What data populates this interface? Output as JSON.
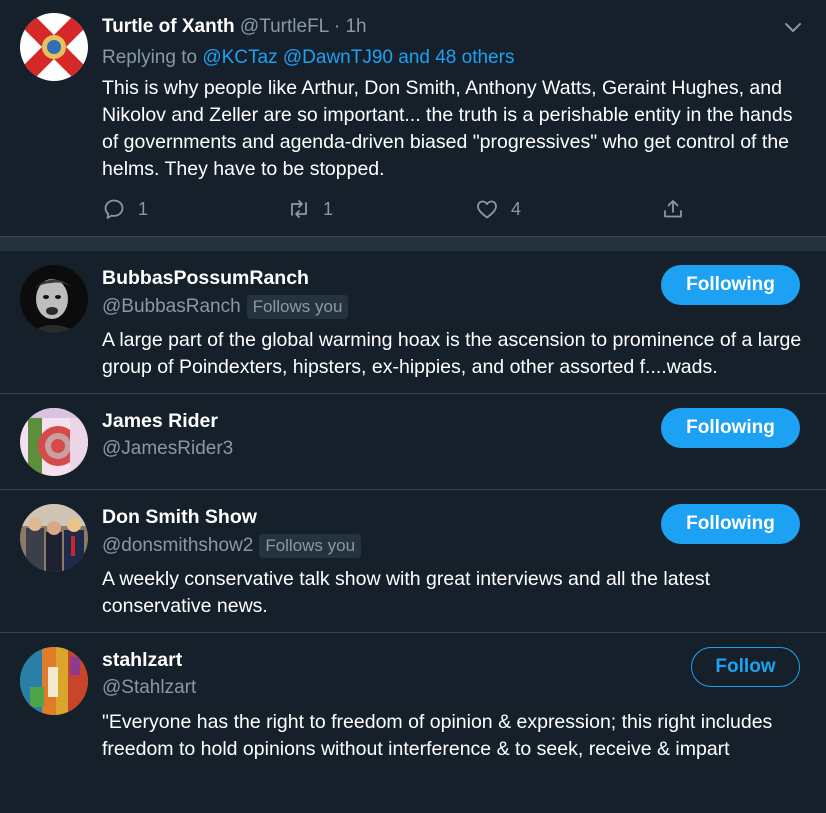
{
  "tweet": {
    "author_name": "Turtle of Xanth",
    "author_handle": "@TurtleFL",
    "dot": "·",
    "time": "1h",
    "replying_prefix": "Replying to",
    "replying_links": "@KCTaz @DawnTJ90 and 48 others",
    "text": "This is why people like Arthur, Don Smith, Anthony Watts, Geraint Hughes, and Nikolov and Zeller are so important... the truth is a perishable entity in the hands of governments and agenda-driven biased \"progressives\" who get control of the helms. They have to be stopped.",
    "reply_count": "1",
    "retweet_count": "1",
    "like_count": "4"
  },
  "users": [
    {
      "name": "BubbasPossumRanch",
      "handle": "@BubbasRanch",
      "follows_you": "Follows you",
      "bio": "A large part of the global warming hoax is the ascension to prominence of a large group of Poindexters, hipsters, ex-hippies, and other assorted f....wads.",
      "button": "Following"
    },
    {
      "name": "James Rider",
      "handle": "@JamesRider3",
      "button": "Following"
    },
    {
      "name": "Don Smith Show",
      "handle": "@donsmithshow2",
      "follows_you": "Follows you",
      "bio": "A weekly conservative talk show with great interviews and all the latest conservative news.",
      "button": "Following"
    },
    {
      "name": "stahlzart",
      "handle": "@Stahlzart",
      "bio": "\"Everyone has the right to freedom of opinion & expression; this right includes freedom to hold opinions without interference & to seek, receive & impart",
      "button": "Follow"
    }
  ],
  "colors": {
    "background": "#15202b",
    "accent": "#1da1f2",
    "muted_text": "#8899a6",
    "divider": "#38444d"
  }
}
